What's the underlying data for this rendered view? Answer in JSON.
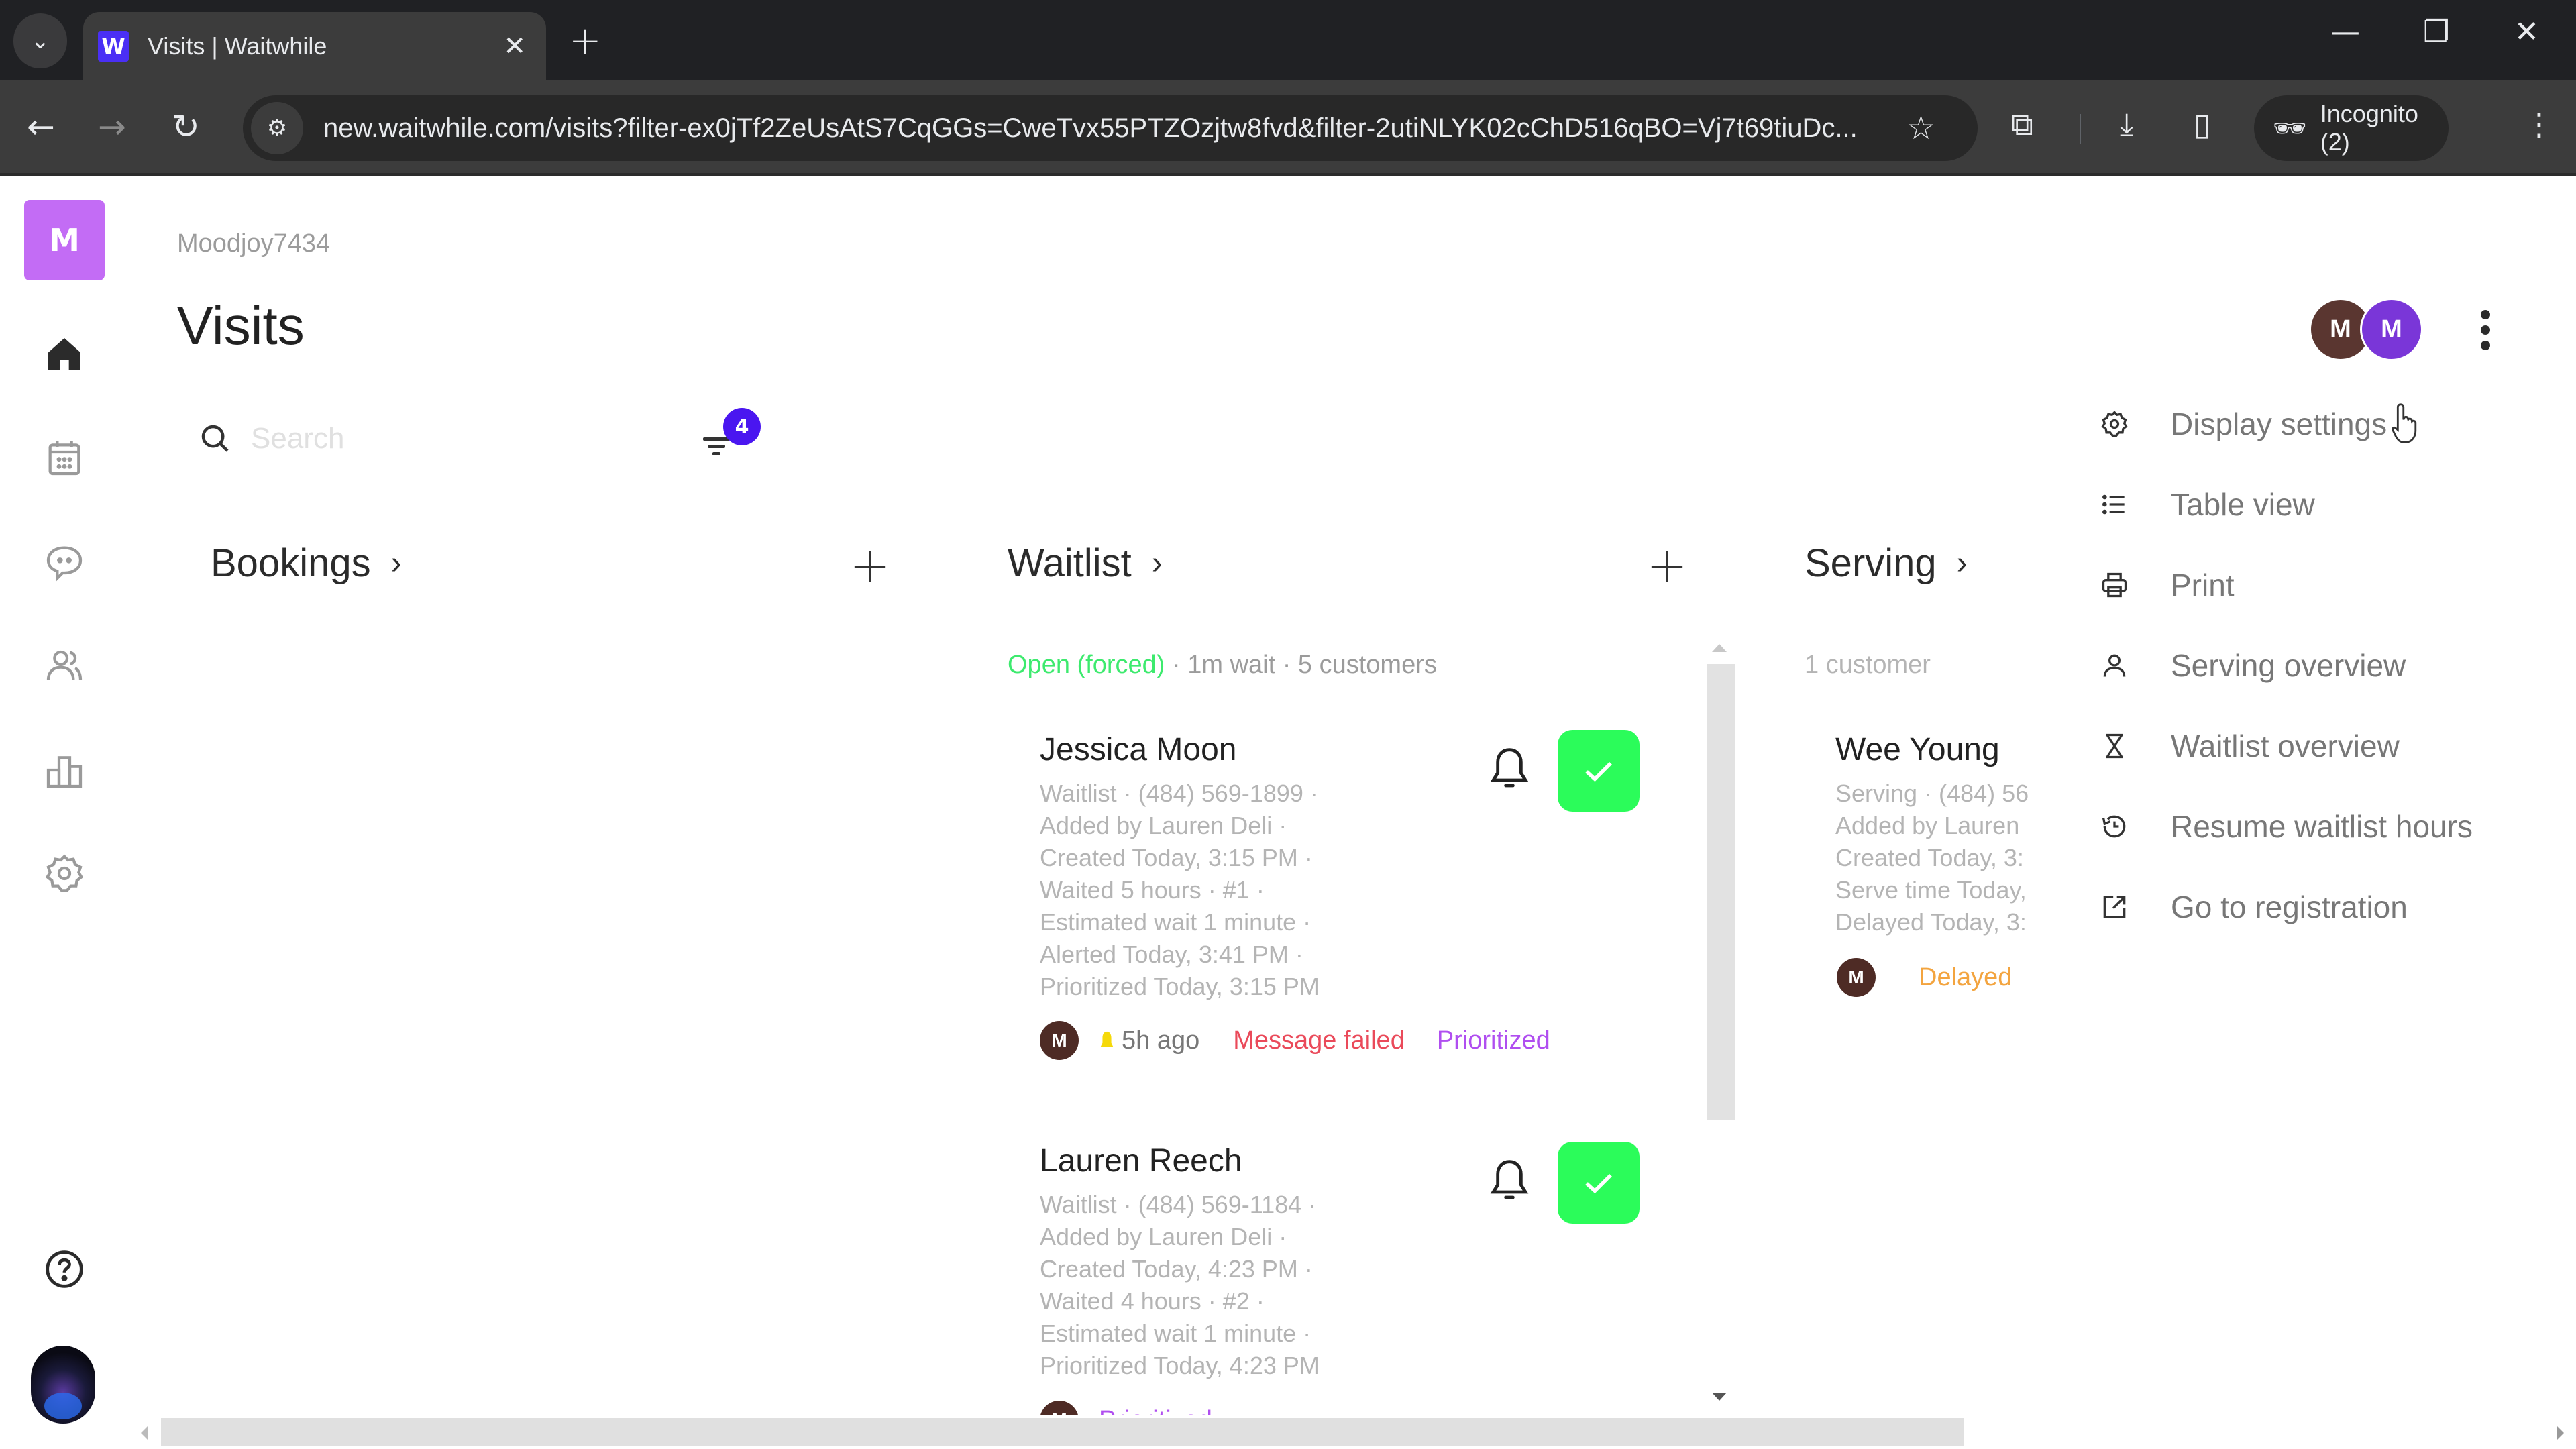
{
  "browser": {
    "tab_title": "Visits | Waitwhile",
    "favicon_letter": "W",
    "url": "new.waitwhile.com/visits?filter-ex0jTf2ZeUsAtS7CqGGs=CweTvx55PTZOzjtw8fvd&filter-2utiNLYK02cChD516qBO=Vj7t69tiuDc...",
    "incognito_label": "Incognito (2)",
    "icons": [
      "tab-search-icon",
      "close-icon",
      "new-tab-icon",
      "minimize-icon",
      "restore-icon",
      "window-close-icon",
      "back-icon",
      "forward-icon",
      "reload-icon",
      "site-info-icon",
      "bookmark-star-icon",
      "extensions-icon",
      "download-icon",
      "side-panel-icon",
      "incognito-icon",
      "browser-menu-icon"
    ]
  },
  "sidebar": {
    "org_badge": "M",
    "items": [
      {
        "name": "home",
        "icon": "home-icon",
        "active": true
      },
      {
        "name": "calendar",
        "icon": "calendar-icon"
      },
      {
        "name": "messages",
        "icon": "chat-icon"
      },
      {
        "name": "customers",
        "icon": "users-icon"
      },
      {
        "name": "analytics",
        "icon": "bar-chart-icon"
      },
      {
        "name": "settings",
        "icon": "gear-icon"
      }
    ],
    "help_icon": "help-icon"
  },
  "header": {
    "org_name": "Moodjoy7434",
    "title": "Visits",
    "avatars": [
      {
        "initial": "M",
        "color": "#5a3630"
      },
      {
        "initial": "M",
        "color": "#7a36d8"
      }
    ]
  },
  "search": {
    "placeholder": "Search",
    "value": "",
    "filter_count": "4"
  },
  "columns": {
    "bookings": {
      "title": "Bookings"
    },
    "waitlist": {
      "title": "Waitlist",
      "status": "Open (forced)",
      "meta": " · 1m wait · 5 customers",
      "cards": [
        {
          "name": "Jessica Moon",
          "lines": [
            "Waitlist · (484) 569-1899 ·",
            "Added by Lauren Deli ·",
            "Created Today, 3:15 PM ·",
            "Waited 5 hours · #1 ·",
            "Estimated wait 1 minute ·",
            "Alerted Today, 3:41 PM ·",
            "Prioritized Today, 3:15 PM"
          ],
          "avatar": "M",
          "ago": "5h ago",
          "tags": [
            "Message failed",
            "Prioritized"
          ]
        },
        {
          "name": "Lauren Reech",
          "lines": [
            "Waitlist · (484) 569-1184 ·",
            "Added by Lauren Deli ·",
            "Created Today, 4:23 PM ·",
            "Waited 4 hours · #2 ·",
            "Estimated wait 1 minute ·",
            "Prioritized Today, 4:23 PM"
          ],
          "avatar": "M",
          "tags": [
            "Prioritized"
          ]
        }
      ]
    },
    "serving": {
      "title": "Serving",
      "meta": "1 customer",
      "cards": [
        {
          "name": "Wee Young",
          "lines": [
            "Serving · (484) 56",
            "Added by Lauren",
            "Created Today, 3:",
            "Serve time Today,",
            "Delayed Today, 3:"
          ],
          "avatar": "M",
          "status": "Delayed"
        }
      ]
    }
  },
  "menu": {
    "items": [
      {
        "label": "Display settings",
        "icon": "gear-icon"
      },
      {
        "label": "Table view",
        "icon": "list-icon"
      },
      {
        "label": "Print",
        "icon": "printer-icon"
      },
      {
        "label": "Serving overview",
        "icon": "person-icon"
      },
      {
        "label": "Waitlist overview",
        "icon": "hourglass-icon"
      },
      {
        "label": "Resume waitlist hours",
        "icon": "history-icon"
      },
      {
        "label": "Go to registration",
        "icon": "external-link-icon"
      }
    ]
  },
  "colors": {
    "brand": "#4a16f0",
    "org_badge": "#c36cf5",
    "check_button": "#2bfc5a",
    "open_status": "#3dea6e",
    "message_failed": "#ea4a5a",
    "prioritized": "#b04ef0",
    "delayed": "#f3a43f"
  }
}
